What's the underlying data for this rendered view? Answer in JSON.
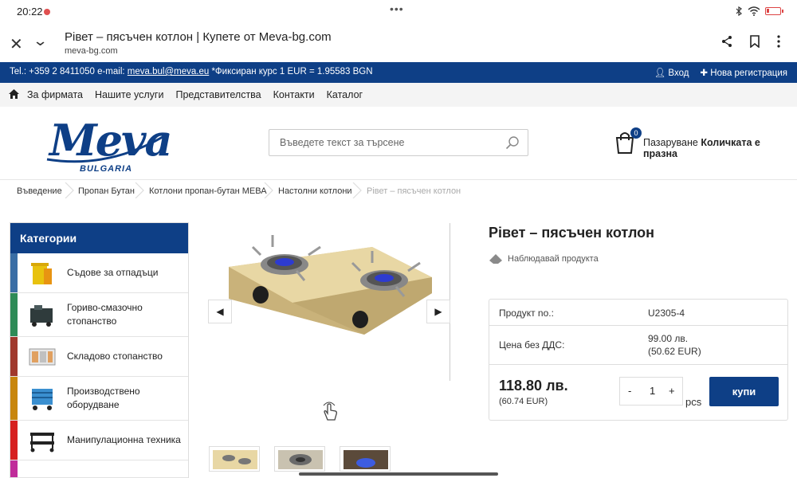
{
  "status_bar": {
    "time": "20:22",
    "menu_dots": "•••"
  },
  "browser": {
    "page_title": "Рівет – пясъчен котлон | Купете от Meva-bg.com",
    "url": "meva-bg.com"
  },
  "topbar": {
    "contact_prefix": "Tel.: +359 2 8411050 e-mail: ",
    "email": "meva.bul@meva.eu",
    "rate": " *Фиксиран курс 1 EUR = 1.95583 BGN",
    "login": "Вход",
    "register": "Нова регистрация"
  },
  "nav": {
    "items": [
      "За фирмата",
      "Нашите услуги",
      "Представителства",
      "Контакти",
      "Каталог"
    ]
  },
  "logo": {
    "brand": "Meva",
    "sub": "BULGARIA"
  },
  "search": {
    "placeholder": "Въведете текст за търсене"
  },
  "cart": {
    "count": "0",
    "label": "Пазаруване",
    "status": "Количката е празна"
  },
  "breadcrumb": [
    "Въведение",
    "Пропан Бутан",
    "Котлони пропан-бутан МЕВА",
    "Настолни котлони",
    "Рівет – пясъчен котлон"
  ],
  "sidebar": {
    "heading": "Категории",
    "items": [
      {
        "label": "Съдове за отпадъци",
        "color": "#3a6ea5"
      },
      {
        "label": "Гориво-смазочно стопанство",
        "color": "#2e8b57"
      },
      {
        "label": "Складово стопанство",
        "color": "#a0392d"
      },
      {
        "label": "Производствено оборудване",
        "color": "#c8860d"
      },
      {
        "label": "Манипулационна техника",
        "color": "#d62020"
      },
      {
        "label": "",
        "color": "#c02c9a"
      }
    ]
  },
  "product": {
    "title": "Рівет – пясъчен котлон",
    "watch": "Наблюдавай продукта",
    "number_label": "Продукт no.:",
    "number_value": "U2305-4",
    "price_net_label": "Цена без ДДС:",
    "price_net_bgn": "99.00 лв.",
    "price_net_eur": "(50.62 EUR)",
    "price": "118.80 лв.",
    "price_eur": "(60.74 EUR)",
    "qty_minus": "-",
    "qty_value": "1",
    "qty_plus": "+",
    "unit": "pcs",
    "buy_label": "купи"
  },
  "colors": {
    "brand": "#0e3f86",
    "stove_body": "#d8c38c"
  }
}
